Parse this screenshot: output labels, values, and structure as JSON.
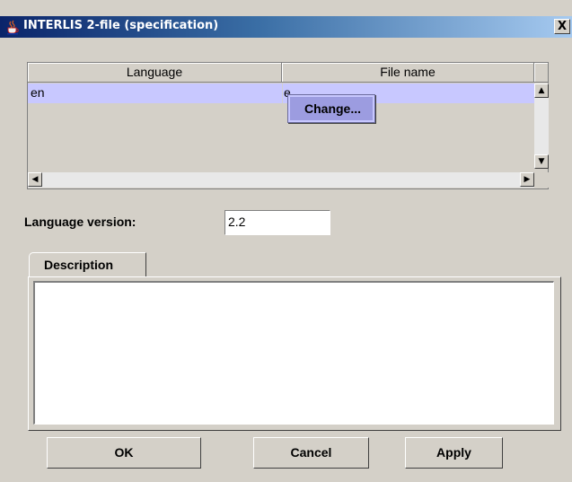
{
  "window": {
    "title": "INTERLIS 2-file (specification)",
    "close_glyph": "X",
    "icon": "java-cup-icon"
  },
  "table": {
    "columns": [
      "Language",
      "File name"
    ],
    "rows": [
      {
        "language": "en",
        "file_name": "e"
      }
    ],
    "selected_row_color": "#c8c8ff"
  },
  "context_menu": {
    "items": [
      "Change..."
    ]
  },
  "language_version": {
    "label": "Language version:",
    "value": "2.2"
  },
  "tabs": [
    {
      "label": "Description",
      "selected": true
    }
  ],
  "description": {
    "value": ""
  },
  "buttons": {
    "ok": "OK",
    "cancel": "Cancel",
    "apply": "Apply"
  },
  "colors": {
    "title_start": "#0a246a",
    "title_end": "#a6caf0",
    "face": "#d4d0c8"
  }
}
